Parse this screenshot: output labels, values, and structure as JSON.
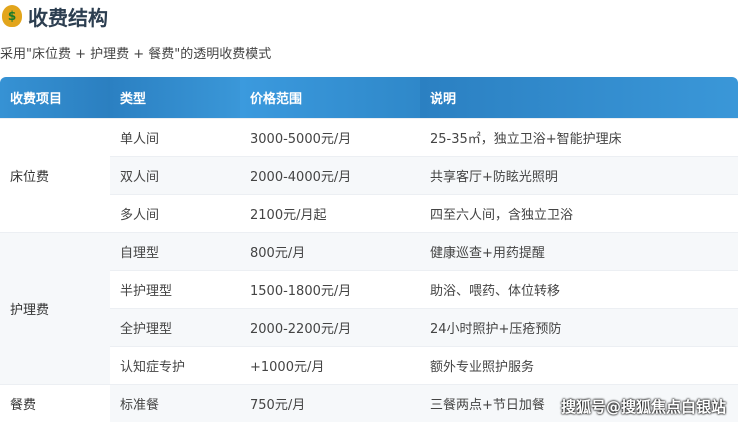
{
  "title": "收费结构",
  "subtitle": "采用\"床位费 + 护理费 + 餐费\"的透明收费模式",
  "headers": [
    "收费项目",
    "类型",
    "价格范围",
    "说明"
  ],
  "groups": [
    "床位费",
    "护理费",
    "餐费"
  ],
  "rows": [
    [
      "单人间",
      "3000-5000元/月",
      "25-35㎡，独立卫浴+智能护理床"
    ],
    [
      "双人间",
      "2000-4000元/月",
      "共享客厅+防眩光照明"
    ],
    [
      "多人间",
      "2100元/月起",
      "四至六人间，含独立卫浴"
    ],
    [
      "自理型",
      "800元/月",
      "健康巡查+用药提醒"
    ],
    [
      "半护理型",
      "1500-1800元/月",
      "助浴、喂药、体位转移"
    ],
    [
      "全护理型",
      "2000-2200元/月",
      "24小时照护+压疮预防"
    ],
    [
      "认知症专护",
      "+1000元/月",
      "额外专业照护服务"
    ],
    [
      "标准餐",
      "750元/月",
      "三餐两点+节日加餐"
    ]
  ],
  "watermark": "搜狐号@搜狐焦点白银站"
}
